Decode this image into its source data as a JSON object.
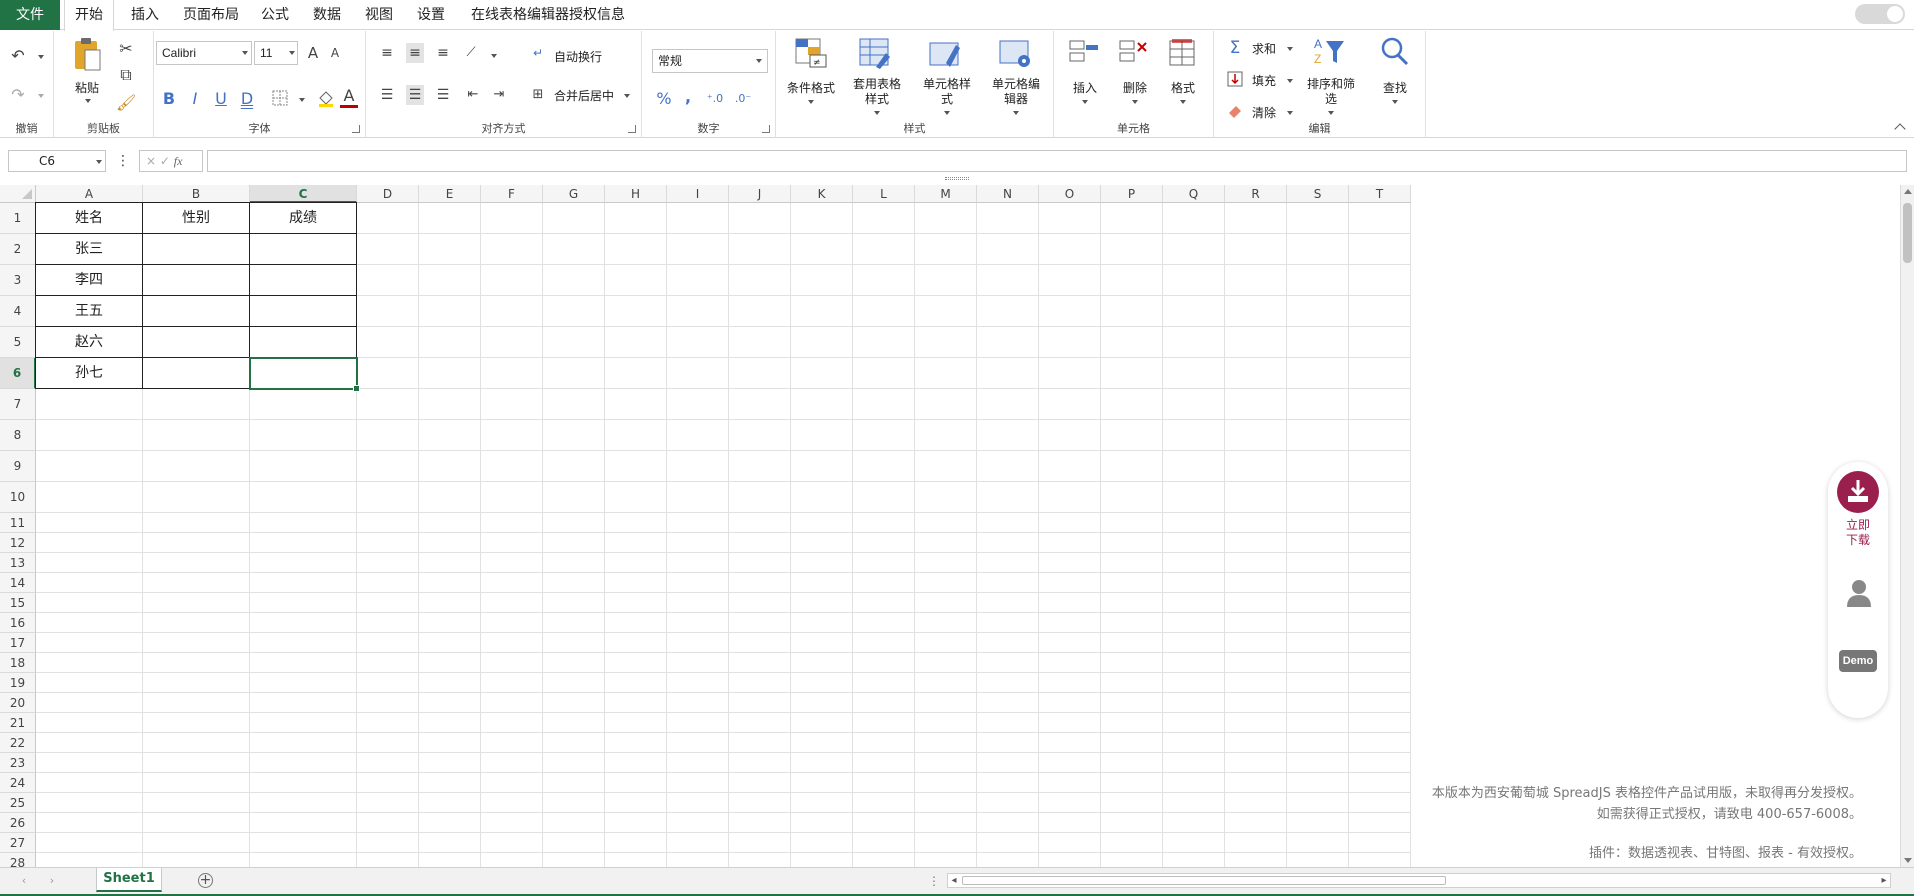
{
  "menu": {
    "tabs": [
      "文件",
      "开始",
      "插入",
      "页面布局",
      "公式",
      "数据",
      "视图",
      "设置",
      "在线表格编辑器授权信息"
    ],
    "active": "开始"
  },
  "ribbon": {
    "undo_group": {
      "label": "撤销"
    },
    "clipboard": {
      "label": "剪贴板",
      "paste": "粘贴"
    },
    "font": {
      "label": "字体",
      "name": "Calibri",
      "size": "11",
      "bold": "B",
      "italic": "I",
      "underline": "U",
      "double_underline": "D",
      "font_color": "A",
      "grow": "A",
      "shrink": "A"
    },
    "alignment": {
      "label": "对齐方式",
      "wrap": "自动换行",
      "merge": "合并后居中"
    },
    "number": {
      "label": "数字",
      "format": "常规",
      "percent": "%",
      "comma": ","
    },
    "styles": {
      "label": "样式",
      "conditional": "条件格式",
      "table_style": "套用表格样式",
      "cell_style": "单元格样式",
      "cell_editor": "单元格编辑器"
    },
    "cells": {
      "label": "单元格",
      "insert": "插入",
      "delete": "删除",
      "format": "格式"
    },
    "editing": {
      "label": "编辑",
      "sum": "求和",
      "fill": "填充",
      "clear": "清除",
      "sort": "排序和筛选",
      "find": "查找"
    }
  },
  "formula_bar": {
    "name_box": "C6",
    "formula": ""
  },
  "columns": [
    "A",
    "B",
    "C",
    "D",
    "E",
    "F",
    "G",
    "H",
    "I",
    "J",
    "K",
    "L",
    "M",
    "N",
    "O",
    "P",
    "Q",
    "R",
    "S",
    "T"
  ],
  "rows": [
    "1",
    "2",
    "3",
    "4",
    "5",
    "6",
    "7",
    "8",
    "9",
    "10",
    "11",
    "12",
    "13",
    "14",
    "15",
    "16",
    "17",
    "18",
    "19",
    "20",
    "21",
    "22",
    "23",
    "24",
    "25",
    "26",
    "27",
    "28"
  ],
  "table": [
    [
      "姓名",
      "性别",
      "成绩"
    ],
    [
      "张三",
      "",
      ""
    ],
    [
      "李四",
      "",
      ""
    ],
    [
      "王五",
      "",
      ""
    ],
    [
      "赵六",
      "",
      ""
    ],
    [
      "孙七",
      "",
      ""
    ]
  ],
  "selected_cell": "C6",
  "watermark": {
    "line1": "本版本为西安葡萄城 SpreadJS 表格控件产品试用版，未取得再分发授权。",
    "line2": "如需获得正式授权，请致电 400-657-6008。",
    "line3": "插件：数据透视表、甘特图、报表 - 有效授权。"
  },
  "side_panel": {
    "download_line1": "立即",
    "download_line2": "下载",
    "demo": "Demo"
  },
  "sheet_tabs": [
    "Sheet1"
  ],
  "colors": {
    "brand": "#217346",
    "download": "#9a1f4d"
  }
}
